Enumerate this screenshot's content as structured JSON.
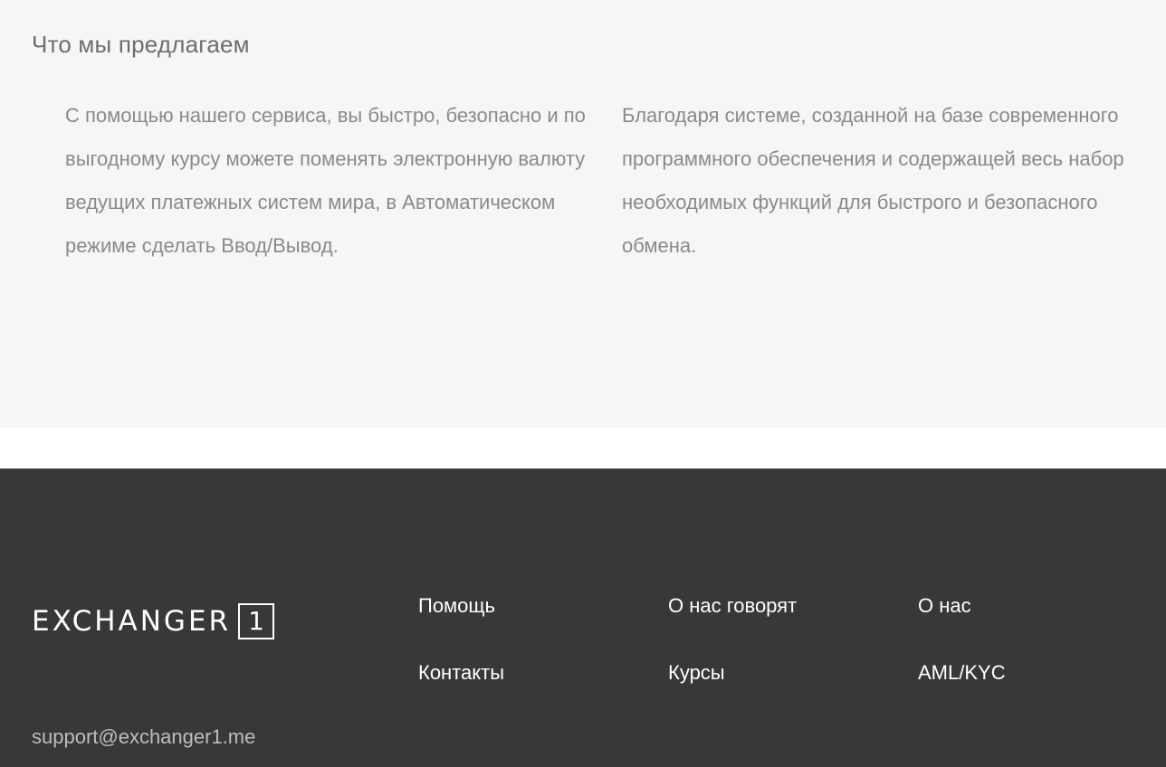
{
  "offer": {
    "title": "Что мы предлагаем",
    "left_text": "С помощью нашего сервиса, вы быстро, безопасно и по выгодному курсу можете поменять электронную валюту ведущих платежных систем мира, в Автоматическом режиме сделать Ввод/Вывод.",
    "right_text": "Благодаря системе, созданной на базе современного программного обеспечения и содержащей весь набор необходимых функций для быстрого и безопасного обмена."
  },
  "footer": {
    "logo_text": "EXCHANGER",
    "logo_number": "1",
    "support_email": "support@exchanger1.me",
    "links": {
      "help": "Помощь",
      "reviews": "О нас говорят",
      "about": "О нас",
      "contacts": "Контакты",
      "rates": "Курсы",
      "aml": "AML/KYC"
    }
  },
  "colors": {
    "offer_bg": "#f6f6f6",
    "footer_bg": "#383838",
    "text_gray": "#8a8a8a",
    "link_white": "#ffffff"
  }
}
